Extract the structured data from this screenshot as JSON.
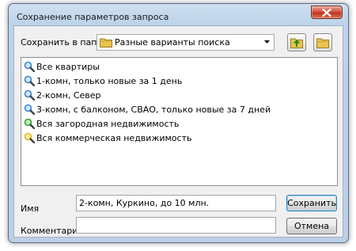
{
  "window": {
    "title": "Сохранение параметров запроса"
  },
  "toolbar": {
    "save_in_label": "Сохранить в папке:",
    "folder_value": "Разные варианты поиска",
    "up_button_icon": "folder-up-icon",
    "new_folder_icon": "new-folder-icon"
  },
  "queries": [
    {
      "label": "Все квартиры",
      "icon": "magnifier-blue-icon"
    },
    {
      "label": "1-комн, только новые за 1 день",
      "icon": "magnifier-blue-icon"
    },
    {
      "label": "2-комн, Север",
      "icon": "magnifier-blue-icon"
    },
    {
      "label": "3-комн, с балконом, СВАО, только новые за 7 дней",
      "icon": "magnifier-blue-icon"
    },
    {
      "label": "Вся загородная недвижимость",
      "icon": "magnifier-green-icon"
    },
    {
      "label": "Вся коммерческая недвижимость",
      "icon": "magnifier-yellow-icon"
    }
  ],
  "form": {
    "name_label": "Имя",
    "name_value": "2-комн, Куркино, до 10 млн.",
    "comment_label": "Комментарий",
    "comment_value": ""
  },
  "buttons": {
    "save": "Сохранить",
    "cancel": "Отмена"
  },
  "colors": {
    "blue_lens": "#3a86d6",
    "green_lens": "#2fa52f",
    "yellow_lens": "#e3b820"
  }
}
